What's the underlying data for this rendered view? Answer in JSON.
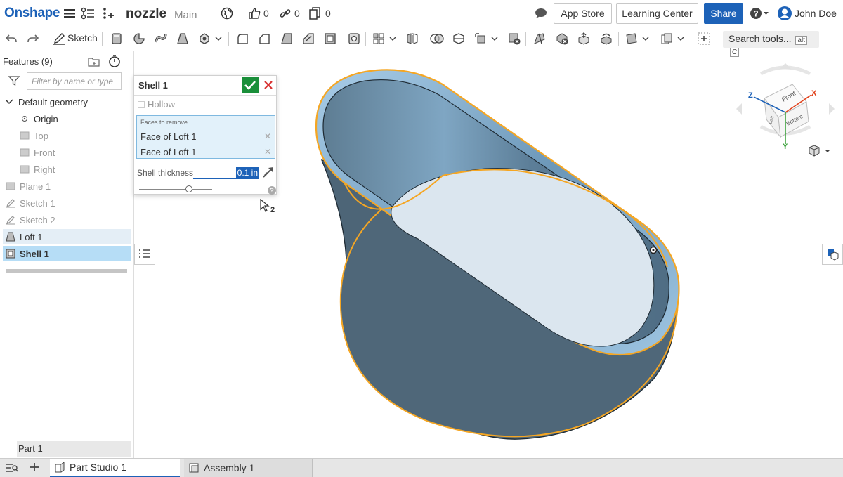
{
  "app": {
    "logo": "Onshape",
    "document_title": "nozzle",
    "branch": "Main",
    "likes": "0",
    "links": "0",
    "copies": "0"
  },
  "header": {
    "app_store": "App Store",
    "learning_center": "Learning Center",
    "share": "Share",
    "user": "John Doe"
  },
  "toolbar": {
    "sketch_label": "Sketch",
    "search_label": "Search tools...",
    "search_key1": "alt",
    "search_key2": "C"
  },
  "features": {
    "header": "Features (9)",
    "filter_placeholder": "Filter by name or type",
    "items": [
      {
        "label": "Default geometry"
      },
      {
        "label": "Origin"
      },
      {
        "label": "Top"
      },
      {
        "label": "Front"
      },
      {
        "label": "Right"
      },
      {
        "label": "Plane 1"
      },
      {
        "label": "Sketch 1"
      },
      {
        "label": "Sketch 2"
      },
      {
        "label": "Loft 1"
      },
      {
        "label": "Shell 1"
      }
    ],
    "part": "Part 1"
  },
  "dialog": {
    "title": "Shell 1",
    "hollow_label": "Hollow",
    "faces_label": "Faces to remove",
    "faces": [
      "Face of Loft 1",
      "Face of Loft 1"
    ],
    "thickness_label": "Shell thickness",
    "thickness_value": "0.1 in",
    "slider_fraction": 0.68
  },
  "cursor_badge": "2",
  "viewcube": {
    "front": "Front",
    "bottom": "Bottom",
    "left": "Left",
    "axis_x": "X",
    "axis_y": "Y",
    "axis_z": "Z",
    "colors": {
      "x": "#e0401a",
      "y": "#3fa33f",
      "z": "#1d62b8"
    }
  },
  "tabs": [
    {
      "label": "Part Studio 1",
      "active": true
    },
    {
      "label": "Assembly 1",
      "active": false
    }
  ],
  "colors": {
    "brand": "#1d62b8",
    "selection": "#f5a623",
    "model": "#4d6577"
  }
}
